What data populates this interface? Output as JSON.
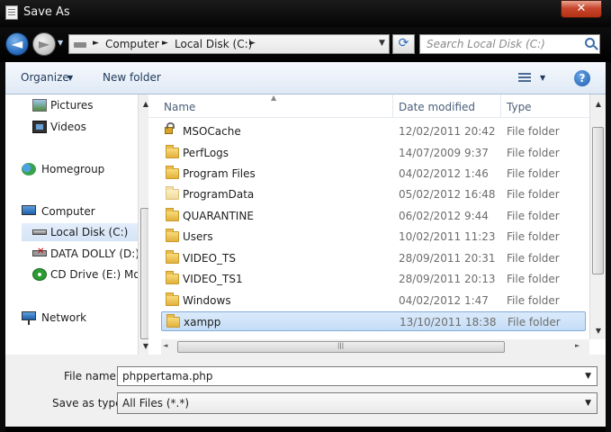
{
  "window": {
    "title": "Save As",
    "close_glyph": "✕"
  },
  "address": {
    "crumbs": [
      "Computer",
      "Local Disk (C:)"
    ],
    "search_placeholder": "Search Local Disk (C:)"
  },
  "toolbar": {
    "organize": "Organize",
    "new_folder": "New folder",
    "help": "?"
  },
  "nav": [
    {
      "label": "Pictures",
      "icon": "pictures-icon"
    },
    {
      "label": "Videos",
      "icon": "videos-icon"
    },
    {
      "label": "Homegroup",
      "icon": "homegroup-icon"
    },
    {
      "label": "Computer",
      "icon": "computer-icon"
    },
    {
      "label": "Local Disk (C:)",
      "icon": "disk-icon",
      "selected": true
    },
    {
      "label": "DATA DOLLY (D:)",
      "icon": "disconnected-drive-icon"
    },
    {
      "label": "CD Drive (E:) Mob",
      "icon": "cd-drive-icon"
    },
    {
      "label": "Network",
      "icon": "network-icon"
    }
  ],
  "columns": {
    "name": "Name",
    "date": "Date modified",
    "type": "Type"
  },
  "files": [
    {
      "name": "MSOCache",
      "date": "12/02/2011 20:42",
      "type": "File folder",
      "icon": "locked-folder-icon"
    },
    {
      "name": "PerfLogs",
      "date": "14/07/2009 9:37",
      "type": "File folder",
      "icon": "folder-icon"
    },
    {
      "name": "Program Files",
      "date": "04/02/2012 1:46",
      "type": "File folder",
      "icon": "folder-icon"
    },
    {
      "name": "ProgramData",
      "date": "05/02/2012 16:48",
      "type": "File folder",
      "icon": "hidden-folder-icon"
    },
    {
      "name": "QUARANTINE",
      "date": "06/02/2012 9:44",
      "type": "File folder",
      "icon": "folder-icon"
    },
    {
      "name": "Users",
      "date": "10/02/2011 11:23",
      "type": "File folder",
      "icon": "folder-icon"
    },
    {
      "name": "VIDEO_TS",
      "date": "28/09/2011 20:31",
      "type": "File folder",
      "icon": "folder-icon"
    },
    {
      "name": "VIDEO_TS1",
      "date": "28/09/2011 20:13",
      "type": "File folder",
      "icon": "folder-icon"
    },
    {
      "name": "Windows",
      "date": "04/02/2012 1:47",
      "type": "File folder",
      "icon": "folder-icon"
    },
    {
      "name": "xampp",
      "date": "13/10/2011 18:38",
      "type": "File folder",
      "icon": "folder-icon",
      "selected": true
    }
  ],
  "form": {
    "filename_label": "File name:",
    "filename_value": "phppertama.php",
    "savetype_label": "Save as type:",
    "savetype_value": "All Files  (*.*)"
  }
}
